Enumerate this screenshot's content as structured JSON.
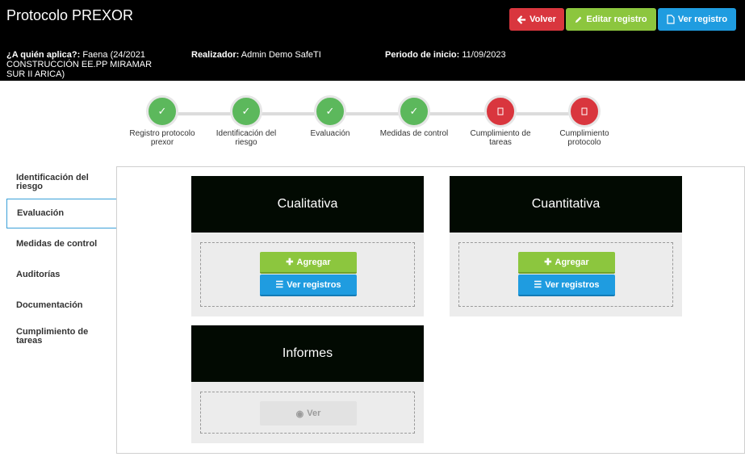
{
  "header": {
    "title": "Protocolo PREXOR",
    "buttons": {
      "back": "Volver",
      "edit": "Editar registro",
      "view": "Ver registro"
    },
    "applies_to_label": "¿A quién aplica?:",
    "applies_to_value": "Faena (24/2021 CONSTRUCCIÓN EE.PP MIRAMAR SUR II ARICA)",
    "realizer_label": "Realizador:",
    "realizer_value": "Admin Demo SafeTI",
    "start_label": "Periodo de inicio:",
    "start_value": "11/09/2023"
  },
  "steps": [
    {
      "label": "Registro protocolo prexor",
      "status": "done"
    },
    {
      "label": "Identificación del riesgo",
      "status": "done"
    },
    {
      "label": "Evaluación",
      "status": "done"
    },
    {
      "label": "Medidas de control",
      "status": "done"
    },
    {
      "label": "Cumplimiento de tareas",
      "status": "pending"
    },
    {
      "label": "Cumplimiento protocolo",
      "status": "pending"
    }
  ],
  "sidebar": {
    "items": [
      {
        "label": "Identificación del riesgo"
      },
      {
        "label": "Evaluación"
      },
      {
        "label": "Medidas de control"
      },
      {
        "label": "Auditorías"
      },
      {
        "label": "Documentación"
      },
      {
        "label": "Cumplimiento de tareas"
      }
    ]
  },
  "cards": {
    "cualitativa": {
      "title": "Cualitativa",
      "add": "Agregar",
      "list": "Ver registros"
    },
    "cuantitativa": {
      "title": "Cuantitativa",
      "add": "Agregar",
      "list": "Ver registros"
    },
    "informes": {
      "title": "Informes",
      "view": "Ver"
    }
  },
  "colors": {
    "header_bg": "#000000",
    "danger": "#d9363e",
    "success": "#8cc63e",
    "info": "#1f9ce0",
    "step_done": "#5cb85c"
  }
}
